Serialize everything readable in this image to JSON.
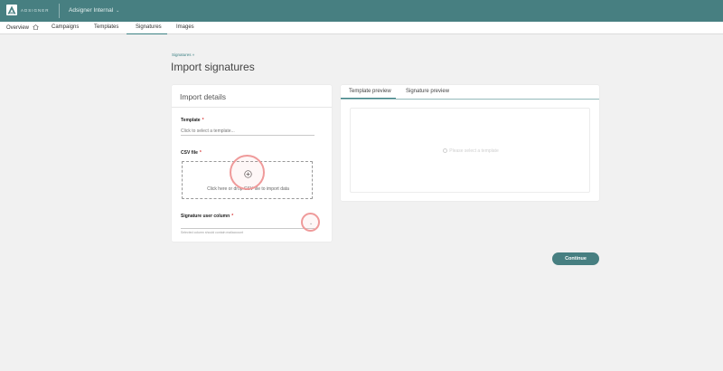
{
  "header": {
    "logo_text": "ADSIGNER",
    "org_name": "Adsigner Internal",
    "org_chevron": "⌄"
  },
  "nav": {
    "items": [
      {
        "label": "Overview"
      },
      {
        "label": "Campaigns"
      },
      {
        "label": "Templates"
      },
      {
        "label": "Signatures"
      },
      {
        "label": "Images"
      }
    ],
    "active": "Signatures"
  },
  "page": {
    "breadcrumb": "Signatures »",
    "title": "Import signatures"
  },
  "import_details": {
    "title": "Import details",
    "template_label": "Template",
    "template_placeholder": "Click to select a template...",
    "csv_label": "CSV file",
    "dropzone_text": "Click here or drop CSV file to import data",
    "column_label": "Signature user column",
    "column_hint": "Selected column should contain mailaccount",
    "required_mark": "*"
  },
  "preview": {
    "tabs": [
      {
        "label": "Template preview"
      },
      {
        "label": "Signature preview"
      }
    ],
    "active_tab": "Template preview",
    "empty_message": "Please select a template"
  },
  "actions": {
    "continue_label": "Continue"
  },
  "colors": {
    "brand": "#477f81",
    "accent": "#3d8184",
    "required": "#d83a3a",
    "highlight_ring": "#ef9a9a"
  }
}
